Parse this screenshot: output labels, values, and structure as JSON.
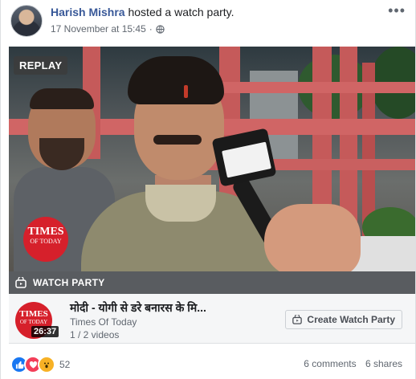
{
  "post": {
    "author": "Harish Mishra",
    "action": "hosted a watch party.",
    "timestamp": "17 November at 15:45",
    "privacy_icon": "globe-icon",
    "more_icon": "ellipsis-icon",
    "more_label": "•••"
  },
  "video": {
    "replay_label": "REPLAY",
    "logo_line1": "TIMES",
    "logo_line2": "OF TODAY"
  },
  "watch_party": {
    "label": "WATCH PARTY",
    "icon": "watch-party-icon"
  },
  "playlist": {
    "title": "मोदी - योगी से डरे बनारस के मि...",
    "source": "Times Of Today",
    "count": "1 / 2 videos",
    "duration": "26:37",
    "logo_line1": "TIMES",
    "logo_line2": "OF TODAY",
    "create_label": "Create Watch Party"
  },
  "footer": {
    "reaction_icons": [
      "like-icon",
      "love-icon",
      "wow-icon"
    ],
    "reaction_count": "52",
    "comments": "6 comments",
    "shares": "6 shares"
  },
  "colors": {
    "author": "#385898",
    "brand_red": "#d6202b",
    "strip": "#595c60"
  }
}
